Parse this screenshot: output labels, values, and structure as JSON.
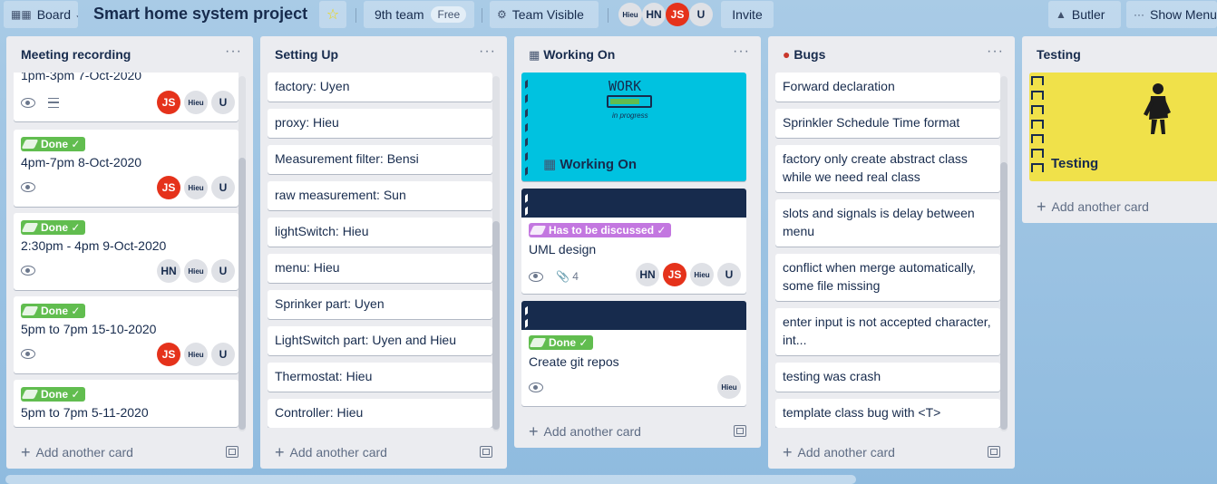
{
  "topbar": {
    "board_switcher": "Board",
    "title": "Smart home system project",
    "team": "9th team",
    "team_badge": "Free",
    "visibility": "Team Visible",
    "members": [
      "Hieu",
      "HN",
      "JS",
      "U"
    ],
    "invite": "Invite",
    "butler": "Butler",
    "show_menu": "Show Menu"
  },
  "lists": [
    {
      "title": "Meeting recording",
      "cards": [
        {
          "text": "1pm-3pm 7-Oct-2020",
          "members": [
            "JS",
            "Hieu",
            "U"
          ]
        },
        {
          "label": "Done",
          "text": "4pm-7pm 8-Oct-2020",
          "members": [
            "JS",
            "Hieu",
            "U"
          ]
        },
        {
          "label": "Done",
          "text": "2:30pm - 4pm 9-Oct-2020",
          "members": [
            "HN",
            "Hieu",
            "U"
          ]
        },
        {
          "label": "Done",
          "text": "5pm to 7pm 15-10-2020",
          "members": [
            "JS",
            "Hieu",
            "U"
          ]
        },
        {
          "label": "Done",
          "text": "5pm to 7pm 5-11-2020"
        }
      ],
      "add": "Add another card"
    },
    {
      "title": "Setting Up",
      "cards": [
        {
          "text": "factory: Uyen"
        },
        {
          "text": "proxy: Hieu"
        },
        {
          "text": "Measurement filter: Bensi"
        },
        {
          "text": "raw measurement: Sun"
        },
        {
          "text": "lightSwitch: Hieu"
        },
        {
          "text": "menu: Hieu"
        },
        {
          "text": "Sprinker part: Uyen"
        },
        {
          "text": "LightSwitch part: Uyen and Hieu"
        },
        {
          "text": "Thermostat: Hieu"
        },
        {
          "text": "Controller: Hieu"
        }
      ],
      "add": "Add another card"
    },
    {
      "title": "Working On",
      "cover_work": "WORK",
      "cover_progress": "in progress",
      "cover_title": "Working On",
      "cards": [
        {
          "label": "Has to be discussed",
          "text": "UML design",
          "attachments": "4",
          "members": [
            "HN",
            "JS",
            "Hieu",
            "U"
          ]
        },
        {
          "label": "Done",
          "text": "Create git repos",
          "members": [
            "Hieu"
          ]
        }
      ],
      "add": "Add another card"
    },
    {
      "title": "Bugs",
      "cards": [
        {
          "text": "Forward declaration"
        },
        {
          "text": "Sprinkler Schedule Time format"
        },
        {
          "text": "factory only create abstract class while we need real class"
        },
        {
          "text": "slots and signals is delay between menu"
        },
        {
          "text": "conflict when merge automatically, some file missing"
        },
        {
          "text": "enter input is not accepted character, int..."
        },
        {
          "text": "testing was crash"
        },
        {
          "text": "template class bug with <T>"
        }
      ],
      "add": "Add another card"
    },
    {
      "title": "Testing",
      "cover_title": "Testing",
      "add": "Add another card"
    }
  ],
  "colors": {
    "red_avatar": "#e5321b",
    "done_label": "#61bd4f",
    "discuss_label": "#c377e0",
    "cover_cyan": "#00c2e0",
    "cover_navy": "#172b4d",
    "cover_yellow": "#f0e14a"
  }
}
